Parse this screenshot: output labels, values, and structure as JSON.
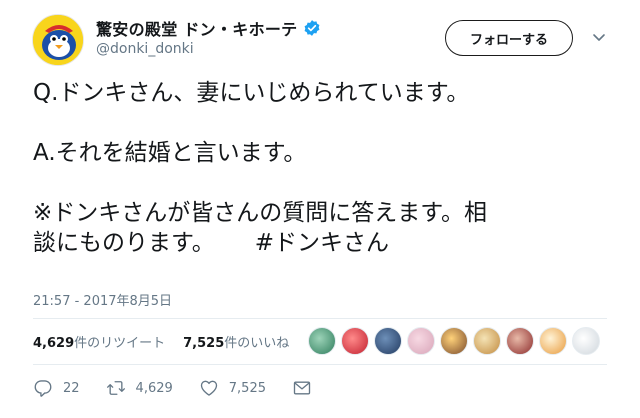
{
  "user": {
    "display_name": "驚安の殿堂 ドン・キホーテ",
    "handle": "@donki_donki",
    "verified": true
  },
  "follow_button": {
    "label": "フォローする"
  },
  "tweet": {
    "lines": [
      "Q.ドンキさん、妻にいじめられています。",
      "",
      "A.それを結婚と言います。",
      "",
      "※ドンキさんが皆さんの質問に答えます。相",
      "談にものります。"
    ],
    "hashtag": "#ドンキさん",
    "timestamp": "21:57 - 2017年8月5日"
  },
  "stats": {
    "retweets_count": "4,629",
    "retweets_label": "件のリツイート",
    "likes_count": "7,525",
    "likes_label": "件のいいね"
  },
  "likers_count": 9,
  "actions": {
    "reply_count": "22",
    "retweet_count": "4,629",
    "like_count": "7,525"
  },
  "colors": {
    "text": "#14171a",
    "secondary": "#657786",
    "verified": "#1da1f2",
    "divider": "#e6ecf0"
  },
  "icons": [
    "avatar-mascot",
    "verified-badge-icon",
    "follow-plus-icon",
    "chevron-down-icon",
    "reply-icon",
    "retweet-icon",
    "like-icon",
    "message-icon"
  ]
}
